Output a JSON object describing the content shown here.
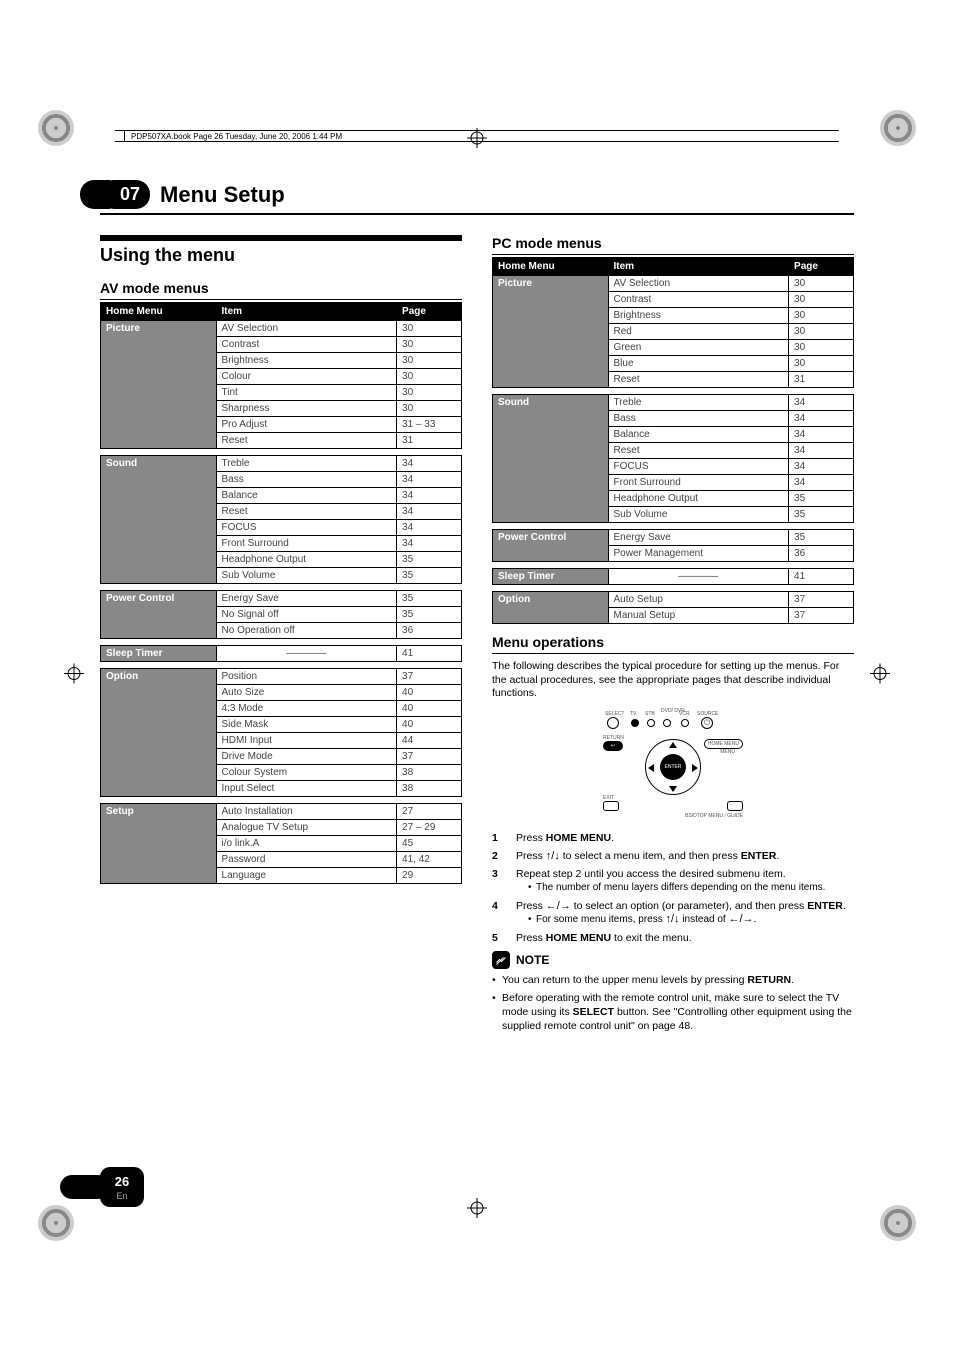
{
  "book_header": "PDP507XA.book  Page 26  Tuesday, June 20, 2006  1:44 PM",
  "chapter_num": "07",
  "chapter_title": "Menu Setup",
  "section_title": "Using the menu",
  "av_title": "AV mode menus",
  "pc_title": "PC mode menus",
  "th": {
    "home": "Home Menu",
    "item": "Item",
    "page": "Page"
  },
  "av": [
    {
      "group": "Picture",
      "rows": [
        [
          "AV Selection",
          "30"
        ],
        [
          "Contrast",
          "30"
        ],
        [
          "Brightness",
          "30"
        ],
        [
          "Colour",
          "30"
        ],
        [
          "Tint",
          "30"
        ],
        [
          "Sharpness",
          "30"
        ],
        [
          "Pro Adjust",
          "31 – 33"
        ],
        [
          "Reset",
          "31"
        ]
      ]
    },
    {
      "group": "Sound",
      "rows": [
        [
          "Treble",
          "34"
        ],
        [
          "Bass",
          "34"
        ],
        [
          "Balance",
          "34"
        ],
        [
          "Reset",
          "34"
        ],
        [
          "FOCUS",
          "34"
        ],
        [
          "Front Surround",
          "34"
        ],
        [
          "Headphone Output",
          "35"
        ],
        [
          "Sub Volume",
          "35"
        ]
      ]
    },
    {
      "group": "Power Control",
      "rows": [
        [
          "Energy Save",
          "35"
        ],
        [
          "No Signal off",
          "35"
        ],
        [
          "No Operation off",
          "36"
        ]
      ]
    },
    {
      "group": "Sleep Timer",
      "rows": [
        [
          "—dash—",
          "41"
        ]
      ]
    },
    {
      "group": "Option",
      "rows": [
        [
          "Position",
          "37"
        ],
        [
          "Auto Size",
          "40"
        ],
        [
          "4:3 Mode",
          "40"
        ],
        [
          "Side Mask",
          "40"
        ],
        [
          "HDMI Input",
          "44"
        ],
        [
          "Drive Mode",
          "37"
        ],
        [
          "Colour System",
          "38"
        ],
        [
          "Input Select",
          "38"
        ]
      ]
    },
    {
      "group": "Setup",
      "rows": [
        [
          "Auto Installation",
          "27"
        ],
        [
          "Analogue TV Setup",
          "27 – 29"
        ],
        [
          "i/o link.A",
          "45"
        ],
        [
          "Password",
          "41, 42"
        ],
        [
          "Language",
          "29"
        ]
      ]
    }
  ],
  "pc": [
    {
      "group": "Picture",
      "rows": [
        [
          "AV Selection",
          "30"
        ],
        [
          "Contrast",
          "30"
        ],
        [
          "Brightness",
          "30"
        ],
        [
          "Red",
          "30"
        ],
        [
          "Green",
          "30"
        ],
        [
          "Blue",
          "30"
        ],
        [
          "Reset",
          "31"
        ]
      ]
    },
    {
      "group": "Sound",
      "rows": [
        [
          "Treble",
          "34"
        ],
        [
          "Bass",
          "34"
        ],
        [
          "Balance",
          "34"
        ],
        [
          "Reset",
          "34"
        ],
        [
          "FOCUS",
          "34"
        ],
        [
          "Front Surround",
          "34"
        ],
        [
          "Headphone Output",
          "35"
        ],
        [
          "Sub Volume",
          "35"
        ]
      ]
    },
    {
      "group": "Power Control",
      "rows": [
        [
          "Energy Save",
          "35"
        ],
        [
          "Power Management",
          "36"
        ]
      ]
    },
    {
      "group": "Sleep Timer",
      "rows": [
        [
          "—dash—",
          "41"
        ]
      ]
    },
    {
      "group": "Option",
      "rows": [
        [
          "Auto Setup",
          "37"
        ],
        [
          "Manual Setup",
          "37"
        ]
      ]
    }
  ],
  "ops_title": "Menu operations",
  "ops_intro": "The following describes the typical procedure for setting up the menus. For the actual procedures, see the appropriate pages that describe individual functions.",
  "remote": {
    "select": "SELECT",
    "tv": "TV",
    "stb": "STB",
    "dvd": "DVD/\nDVR",
    "vcr": "VCR",
    "source": "SOURCE",
    "return": "RETURN",
    "home": "HOME MENU",
    "menu": "MENU",
    "enter": "ENTER",
    "exit": "EXIT",
    "bottom": "BS/DTOP MENU  /  GUIDE"
  },
  "steps": {
    "s1_a": "Press ",
    "s1_b": "HOME MENU",
    "s1_c": ".",
    "s2_a": "Press ",
    "s2_b": " to select a menu item, and then press ",
    "s2_c": "ENTER",
    "s2_d": ".",
    "s3": "Repeat step 2 until you access the desired submenu item.",
    "s3_sub": "The number of menu layers differs depending on the menu items.",
    "s4_a": "Press ",
    "s4_b": " to select an option (or parameter), and then press ",
    "s4_c": "ENTER",
    "s4_d": ".",
    "s4_sub_a": "For some menu items, press ",
    "s4_sub_b": " instead of ",
    "s4_sub_c": ".",
    "s5_a": "Press ",
    "s5_b": "HOME MENU",
    "s5_c": " to exit the menu."
  },
  "note_label": "NOTE",
  "notes": {
    "n1_a": "You can return to the upper menu levels by pressing ",
    "n1_b": "RETURN",
    "n1_c": ".",
    "n2_a": "Before operating with the remote control unit, make sure to select the TV mode using its ",
    "n2_b": "SELECT",
    "n2_c": " button. See \"Controlling other equipment using the supplied remote control unit\" on page 48."
  },
  "page_number": "26",
  "page_lang": "En"
}
